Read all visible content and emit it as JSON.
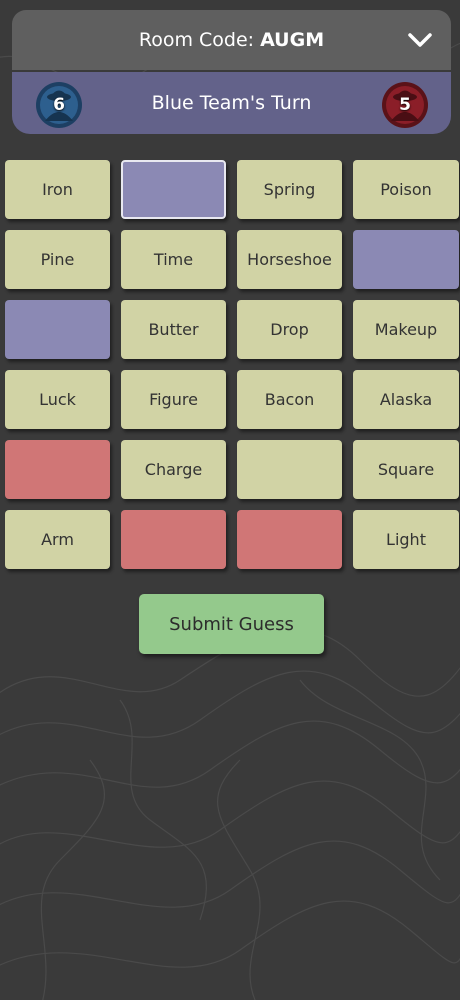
{
  "header": {
    "room_code_label": "Room Code:",
    "room_code": "AUGM",
    "toggle_icon": "chevron-down-icon"
  },
  "turn": {
    "text": "Blue Team's Turn",
    "blue_remaining": "6",
    "red_remaining": "5",
    "blue_icon": "blue-agent-icon",
    "red_icon": "red-agent-icon"
  },
  "board": {
    "cards": [
      {
        "word": "Iron",
        "state": "neutral"
      },
      {
        "word": "",
        "state": "blue",
        "selected": true
      },
      {
        "word": "Spring",
        "state": "neutral"
      },
      {
        "word": "Poison",
        "state": "neutral"
      },
      {
        "word": "Pine",
        "state": "neutral"
      },
      {
        "word": "Time",
        "state": "neutral"
      },
      {
        "word": "Horseshoe",
        "state": "neutral"
      },
      {
        "word": "",
        "state": "blue"
      },
      {
        "word": "",
        "state": "blue"
      },
      {
        "word": "Butter",
        "state": "neutral"
      },
      {
        "word": "Drop",
        "state": "neutral"
      },
      {
        "word": "Makeup",
        "state": "neutral"
      },
      {
        "word": "Luck",
        "state": "neutral"
      },
      {
        "word": "Figure",
        "state": "neutral"
      },
      {
        "word": "Bacon",
        "state": "neutral"
      },
      {
        "word": "Alaska",
        "state": "neutral"
      },
      {
        "word": "",
        "state": "red"
      },
      {
        "word": "Charge",
        "state": "neutral"
      },
      {
        "word": "",
        "state": "neutral"
      },
      {
        "word": "Square",
        "state": "neutral"
      },
      {
        "word": "Arm",
        "state": "neutral"
      },
      {
        "word": "",
        "state": "red"
      },
      {
        "word": "",
        "state": "red"
      },
      {
        "word": "Light",
        "state": "neutral"
      }
    ]
  },
  "actions": {
    "submit_label": "Submit Guess"
  },
  "colors": {
    "background": "#3a3a3a",
    "header": "#5f5f5f",
    "turn_bar": "#63628a",
    "card_neutral": "#d1d3a5",
    "card_blue": "#8b89b4",
    "card_red": "#d07676",
    "submit": "#94c98c"
  }
}
